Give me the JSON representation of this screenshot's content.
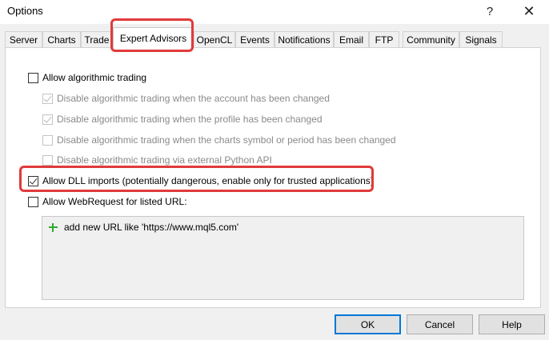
{
  "window": {
    "title": "Options",
    "help_label": "?",
    "close_label": "✕"
  },
  "tabs": [
    {
      "label": "Server"
    },
    {
      "label": "Charts"
    },
    {
      "label": "Trade"
    },
    {
      "label": "Expert Advisors",
      "active": true
    },
    {
      "label": "OpenCL"
    },
    {
      "label": "Events"
    },
    {
      "label": "Notifications"
    },
    {
      "label": "Email"
    },
    {
      "label": "FTP"
    },
    {
      "label": "Community"
    },
    {
      "label": "Signals"
    }
  ],
  "options": {
    "allow_algo": {
      "label": "Allow algorithmic trading",
      "checked": false,
      "enabled": true
    },
    "disable_account": {
      "label": "Disable algorithmic trading when the account has been changed",
      "checked": true,
      "enabled": false
    },
    "disable_profile": {
      "label": "Disable algorithmic trading when the profile has been changed",
      "checked": true,
      "enabled": false
    },
    "disable_symbol": {
      "label": "Disable algorithmic trading when the charts symbol or period has been changed",
      "checked": false,
      "enabled": false
    },
    "disable_python": {
      "label": "Disable algorithmic trading via external Python API",
      "checked": false,
      "enabled": false
    },
    "allow_dll": {
      "label": "Allow DLL imports (potentially dangerous, enable only for trusted applications)",
      "checked": true,
      "enabled": true
    },
    "allow_webrequest": {
      "label": "Allow WebRequest for listed URL:",
      "checked": false,
      "enabled": true
    }
  },
  "url_list": {
    "add_label": "add new URL like 'https://www.mql5.com'"
  },
  "buttons": {
    "ok": "OK",
    "cancel": "Cancel",
    "help": "Help"
  },
  "colors": {
    "highlight": "#e03a3a",
    "plus_icon": "#2eaa2e"
  }
}
